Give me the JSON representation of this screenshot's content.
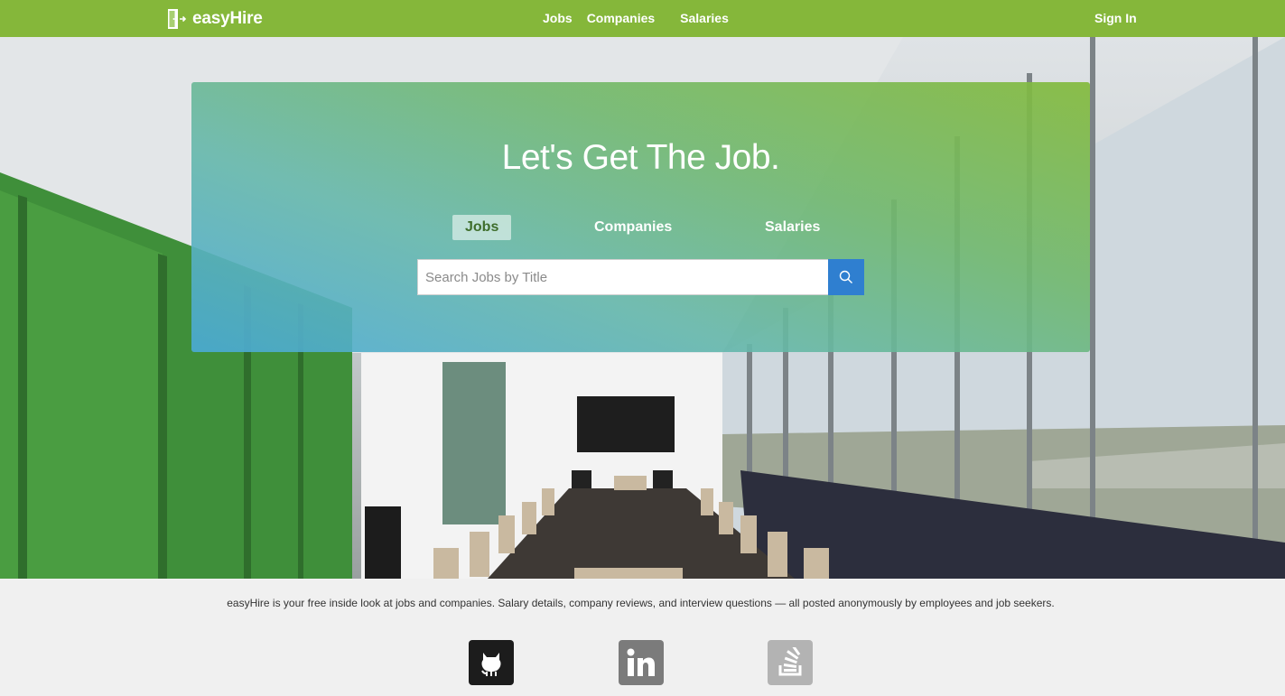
{
  "brand": {
    "name": "easyHire",
    "color": "#85b73a"
  },
  "nav": {
    "links": [
      "Jobs",
      "Companies",
      "Salaries"
    ],
    "signin": "Sign In"
  },
  "hero": {
    "headline": "Let's Get The Job.",
    "tabs": [
      "Jobs",
      "Companies",
      "Salaries"
    ],
    "active_tab": "Jobs",
    "search": {
      "placeholder": "Search Jobs by Title",
      "value": ""
    },
    "search_button_icon": "search-icon"
  },
  "footer": {
    "tagline": "easyHire is your free inside look at jobs and companies. Salary details, company reviews, and interview questions — all posted anonymously by employees and job seekers.",
    "social_icons": [
      "github-icon",
      "linkedin-icon",
      "stackoverflow-icon"
    ]
  }
}
